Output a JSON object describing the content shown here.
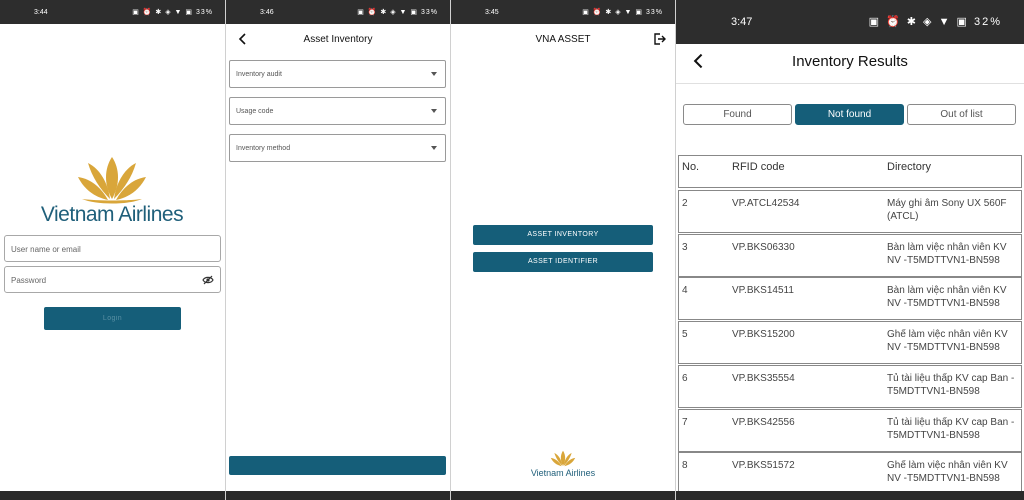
{
  "screens": {
    "login": {
      "status_time": "3:44",
      "status_battery": "33%",
      "brand_name": "Vietnam Airlines",
      "username_placeholder": "User name or email",
      "password_placeholder": "Password",
      "login_label": "Login"
    },
    "asset_inventory": {
      "status_time": "3:46",
      "status_battery": "33%",
      "title": "Asset Inventory",
      "dropdowns": [
        {
          "placeholder": "Inventory audit"
        },
        {
          "placeholder": "Usage code"
        },
        {
          "placeholder": "Inventory method"
        }
      ]
    },
    "vna_asset": {
      "status_time": "3:45",
      "status_battery": "33%",
      "title": "VNA ASSET",
      "buttons": [
        "ASSET INVENTORY",
        "ASSET IDENTIFIER"
      ],
      "brand_name": "Vietnam Airlines"
    },
    "inventory_results": {
      "status_time": "3:47",
      "status_battery": "32%",
      "title": "Inventory Results",
      "tabs": [
        {
          "label": "Found",
          "active": false
        },
        {
          "label": "Not found",
          "active": true
        },
        {
          "label": "Out of list",
          "active": false
        }
      ],
      "columns": [
        "No.",
        "RFID code",
        "Directory"
      ],
      "rows": [
        {
          "no": "2",
          "rfid": "VP.ATCL42534",
          "directory": "Máy ghi âm Sony UX 560F (ATCL)"
        },
        {
          "no": "3",
          "rfid": "VP.BKS06330",
          "directory": "Bàn làm việc nhân viên KV NV -T5MDTTVN1-BN598"
        },
        {
          "no": "4",
          "rfid": "VP.BKS14511",
          "directory": "Bàn làm việc nhân viên KV NV -T5MDTTVN1-BN598"
        },
        {
          "no": "5",
          "rfid": "VP.BKS15200",
          "directory": "Ghế làm việc nhân viên KV NV -T5MDTTVN1-BN598"
        },
        {
          "no": "6",
          "rfid": "VP.BKS35554",
          "directory": "Tủ tài liệu thấp KV cap Ban -T5MDTTVN1-BN598"
        },
        {
          "no": "7",
          "rfid": "VP.BKS42556",
          "directory": "Tủ tài liệu thấp KV cap Ban -T5MDTTVN1-BN598"
        },
        {
          "no": "8",
          "rfid": "VP.BKS51572",
          "directory": "Ghế làm việc nhân viên KV NV -T5MDTTVN1-BN598"
        }
      ]
    }
  },
  "colors": {
    "primary": "#155e79",
    "brand_gold": "#d9a63a",
    "brand_text": "#1f5f7a",
    "statusbar": "#2d2d2d"
  },
  "icons": [
    "back-arrow-icon",
    "logout-icon",
    "eye-off-icon",
    "dropdown-caret-icon",
    "lotus-logo"
  ]
}
